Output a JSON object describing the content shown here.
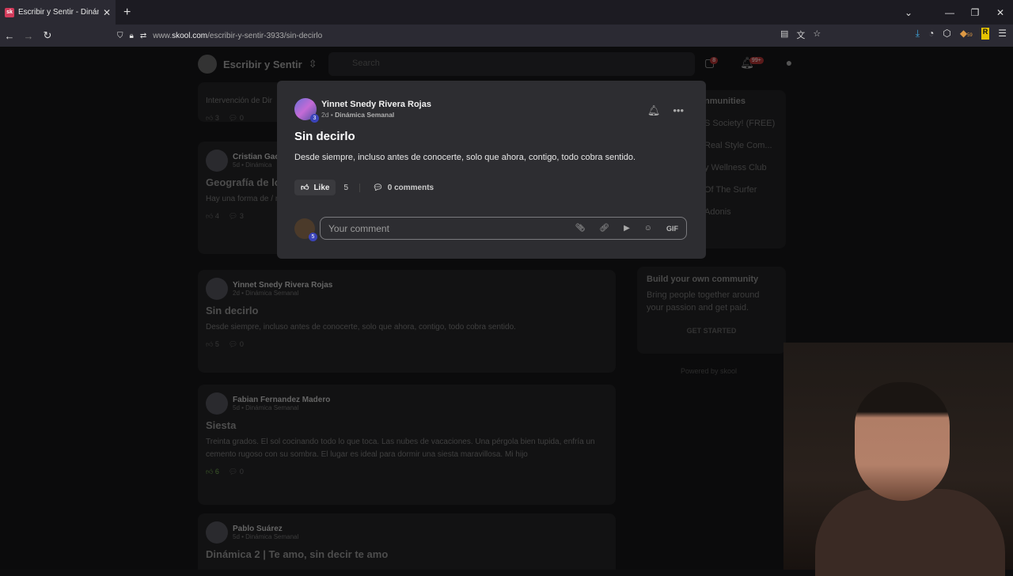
{
  "browser": {
    "tab_title": "Escribir y Sentir - Dinámica Sem",
    "favicon": "sk",
    "url_prefix": "www.",
    "url_domain": "skool.com",
    "url_path": "/escribir-y-sentir-3933/sin-decirlo",
    "ext_badge": "59"
  },
  "site": {
    "name": "Escribir y Sentir",
    "search_placeholder": "Search",
    "chat_badge": "8",
    "notif_badge": "99+"
  },
  "feed": [
    {
      "name": "",
      "sub": "",
      "title": "",
      "body": "Intervención de Dir",
      "likes": "3",
      "comments": "0"
    },
    {
      "name": "Cristian Gac",
      "sub": "5d • Dinámica",
      "title": "Geografía de lo",
      "body": "Hay una forma de / mis manos busque",
      "likes": "4",
      "comments": "3"
    },
    {
      "name": "Yinnet Snedy Rivera Rojas",
      "sub": "2d • Dinámica Semanal",
      "title": "Sin decirlo",
      "body": "Desde siempre, incluso antes de conocerte, solo que ahora, contigo, todo cobra sentido.",
      "likes": "5",
      "comments": "0"
    },
    {
      "name": "Fabian Fernandez Madero",
      "sub": "5d • Dinámica Semanal",
      "title": "Siesta",
      "body": "Treinta grados. El sol cocinando todo lo que toca. Las nubes de vacaciones. Una pérgola bien tupida, enfría un cemento rugoso con su sombra. El lugar es ideal para dormir una siesta maravillosa. Mi hijo",
      "likes": "6",
      "comments": "0"
    },
    {
      "name": "Pablo Suárez",
      "sub": "5d • Dinámica Semanal",
      "title": "Dinámica 2 | Te amo, sin decir te amo",
      "body": "",
      "likes": "",
      "comments": ""
    }
  ],
  "sidebar": {
    "header": "nmunities",
    "items": [
      "S Society! (FREE)",
      "Real Style Com...",
      "y Wellness Club",
      "Of The Surfer",
      "Adonis"
    ],
    "build_title": "Build your own community",
    "build_text": "Bring people together around your passion and get paid.",
    "build_cta": "GET STARTED",
    "powered": "Powered by skool"
  },
  "modal": {
    "author": "Yinnet Snedy Rivera Rojas",
    "level": "3",
    "time": "2d",
    "category": "Dinámica Semanal",
    "title": "Sin decirlo",
    "body": "Desde siempre, incluso antes de conocerte, solo que ahora, contigo, todo cobra sentido.",
    "like_label": "Like",
    "like_count": "5",
    "comments_label": "0 comments",
    "comment_placeholder": "Your comment",
    "commenter_level": "5",
    "gif_label": "GIF"
  }
}
